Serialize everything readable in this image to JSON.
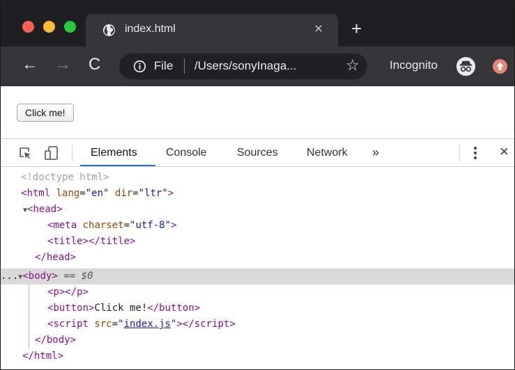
{
  "browser": {
    "tab_title": "index.html",
    "close_glyph": "×",
    "newtab_glyph": "+",
    "icons": {
      "tab": "globe-icon",
      "info": "info-icon",
      "star": "star-icon",
      "incognito": "incognito-icon",
      "extension": "extension-icon"
    },
    "nav": {
      "back": "←",
      "forward": "→",
      "reload": "C"
    },
    "omnibox": {
      "scheme": "File",
      "url": "/Users/sonyInaga...",
      "star": "☆"
    },
    "incognito_label": "Incognito",
    "colors": {
      "titlebar": "#1e1f22",
      "toolbar": "#35363a",
      "omnibox": "#202124",
      "close": "#fe5f57",
      "minimize": "#febc2e",
      "maximize": "#28c840"
    }
  },
  "page": {
    "button_label": "Click me!"
  },
  "devtools": {
    "tabs": [
      "Elements",
      "Console",
      "Sources",
      "Network"
    ],
    "active_tab": "Elements",
    "more_tabs": "»",
    "close": "×",
    "accent": "#1a73e8",
    "dom": {
      "doctype": "<!doctype html>",
      "html_open": {
        "tag": "html",
        "attr1": "lang",
        "val1": "en",
        "attr2": "dir",
        "val2": "ltr"
      },
      "head": "head",
      "meta": {
        "tag": "meta",
        "attr": "charset",
        "val": "utf-8"
      },
      "title": "title",
      "body": "body",
      "body_marker": "== $0",
      "p": "p",
      "button": {
        "tag": "button",
        "text": "Click me!"
      },
      "script": {
        "tag": "script",
        "attr": "src",
        "val": "index.js"
      },
      "ellipsis": "...",
      "expand": "▼"
    }
  }
}
